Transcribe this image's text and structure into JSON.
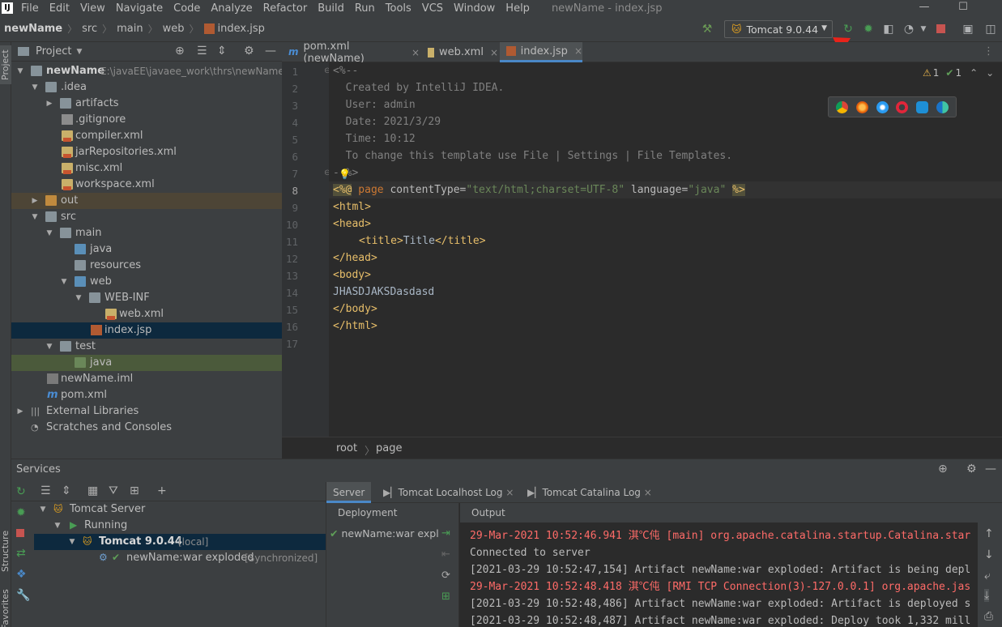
{
  "menubar": {
    "logo": "IJ",
    "items": [
      "File",
      "Edit",
      "View",
      "Navigate",
      "Code",
      "Analyze",
      "Refactor",
      "Build",
      "Run",
      "Tools",
      "VCS",
      "Window",
      "Help"
    ],
    "window_title": "newName - index.jsp",
    "minimize": "—",
    "maximize": "☐"
  },
  "breadcrumbs": [
    "newName",
    "src",
    "main",
    "web",
    "index.jsp"
  ],
  "run_config": {
    "label": "Tomcat 9.0.44"
  },
  "project_panel": {
    "title": "Project",
    "tree": [
      {
        "label": "newName",
        "hint": "E:\\javaEE\\javaee_work\\thrs\\newName"
      },
      {
        "label": ".idea"
      },
      {
        "label": "artifacts"
      },
      {
        "label": ".gitignore"
      },
      {
        "label": "compiler.xml"
      },
      {
        "label": "jarRepositories.xml"
      },
      {
        "label": "misc.xml"
      },
      {
        "label": "workspace.xml"
      },
      {
        "label": "out"
      },
      {
        "label": "src"
      },
      {
        "label": "main"
      },
      {
        "label": "java"
      },
      {
        "label": "resources"
      },
      {
        "label": "web"
      },
      {
        "label": "WEB-INF"
      },
      {
        "label": "web.xml"
      },
      {
        "label": "index.jsp"
      },
      {
        "label": "test"
      },
      {
        "label": "java"
      },
      {
        "label": "newName.iml"
      },
      {
        "label": "pom.xml"
      },
      {
        "label": "External Libraries"
      },
      {
        "label": "Scratches and Consoles"
      }
    ]
  },
  "left_stripe": {
    "project": "Project",
    "structure": "Structure",
    "favorites": "Favorites"
  },
  "editor_tabs": [
    {
      "label": "pom.xml (newName)",
      "icon": "m"
    },
    {
      "label": "web.xml",
      "icon": "xml"
    },
    {
      "label": "index.jsp",
      "icon": "jsp"
    }
  ],
  "inspections": {
    "warnings": "1",
    "ok": "1"
  },
  "line_numbers": [
    "1",
    "2",
    "3",
    "4",
    "5",
    "6",
    "7",
    "8",
    "9",
    "10",
    "11",
    "12",
    "13",
    "14",
    "15",
    "16",
    "17"
  ],
  "code": {
    "l1": "<%--",
    "l2": "  Created by IntelliJ IDEA.",
    "l3": "  User: admin",
    "l4": "  Date: 2021/3/29",
    "l5": "  Time: 10:12",
    "l6": "  To change this template use File | Settings | File Templates.",
    "l7": "--%>",
    "l8": {
      "open": "<%@",
      "kw": " page",
      "a1": " contentType=",
      "v1": "\"text/html;charset=UTF-8\"",
      "a2": " language=",
      "v2": "\"java\"",
      "close": "%>"
    },
    "l9": "<html>",
    "l10": "<head>",
    "l11": {
      "open": "<title>",
      "text": "Title",
      "close": "</title>"
    },
    "l12": "</head>",
    "l13": "<body>",
    "l14": "JHASDJAKSDasdasd",
    "l15": "</body>",
    "l16": "</html>"
  },
  "editor_breadcrumb": [
    "root",
    "page"
  ],
  "services": {
    "title": "Services",
    "tree": [
      {
        "label": "Tomcat Server"
      },
      {
        "label": "Running"
      },
      {
        "label": "Tomcat 9.0.44",
        "hint": "[local]"
      },
      {
        "label": "newName:war exploded",
        "hint": "[Synchronized]"
      }
    ],
    "tabs": [
      "Server",
      "Tomcat Localhost Log",
      "Tomcat Catalina Log"
    ],
    "deployment_header": "Deployment",
    "output_header": "Output",
    "deployment_item": "newName:war explo",
    "output": [
      {
        "text": "29-Mar-2021 10:52:46.941 淇℃伅 [main] org.apache.catalina.startup.Catalina.star",
        "kind": "red"
      },
      {
        "text": "Connected to server",
        "kind": "gray"
      },
      {
        "text": "[2021-03-29 10:52:47,154] Artifact newName:war exploded: Artifact is being depl",
        "kind": "gray"
      },
      {
        "text": "29-Mar-2021 10:52:48.418 淇℃伅 [RMI TCP Connection(3)-127.0.0.1] org.apache.jas",
        "kind": "red"
      },
      {
        "text": "[2021-03-29 10:52:48,486] Artifact newName:war exploded: Artifact is deployed s",
        "kind": "gray"
      },
      {
        "text": "[2021-03-29 10:52:48,487] Artifact newName:war exploded: Deploy took 1,332 mill",
        "kind": "gray"
      }
    ]
  },
  "colors": {
    "accent": "#4a88c7",
    "annotation_arrow": "#e8231a",
    "run_green": "#499c54",
    "stop_red": "#c75450"
  }
}
